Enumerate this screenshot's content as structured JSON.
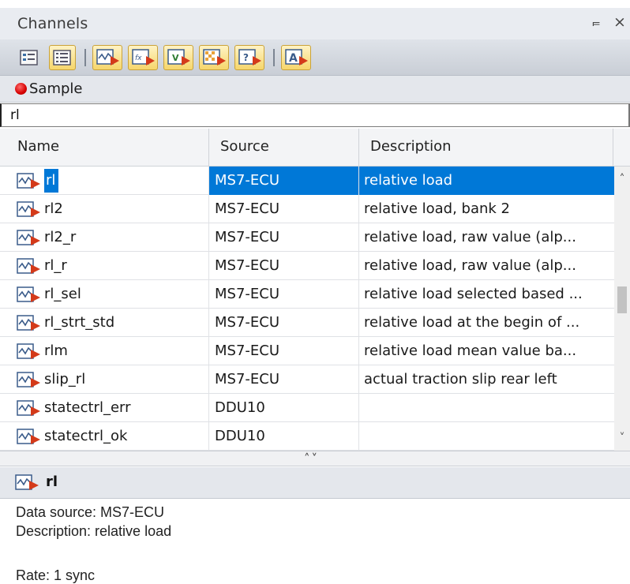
{
  "panel": {
    "title": "Channels",
    "pin_glyph": "⫭",
    "close_glyph": "×"
  },
  "toolbar": {
    "buttons": [
      {
        "icon": "list-view-icon",
        "selected": false
      },
      {
        "icon": "detail-view-icon",
        "selected": true
      },
      {
        "icon": "channel-type-icon",
        "selected": true
      },
      {
        "icon": "function-channel-icon",
        "selected": true
      },
      {
        "icon": "variable-channel-icon",
        "selected": true
      },
      {
        "icon": "map-channel-icon",
        "selected": true
      },
      {
        "icon": "unknown-channel-icon",
        "selected": true
      },
      {
        "icon": "text-channel-icon",
        "selected": true
      }
    ]
  },
  "sample": {
    "label": "Sample",
    "color": "#d60000"
  },
  "filter": {
    "value": "rl"
  },
  "table": {
    "columns": [
      "Name",
      "Source",
      "Description"
    ],
    "rows": [
      {
        "name": "rl",
        "source": "MS7-ECU",
        "description": "relative load",
        "selected": true
      },
      {
        "name": "rl2",
        "source": "MS7-ECU",
        "description": "relative load, bank 2",
        "selected": false
      },
      {
        "name": "rl2_r",
        "source": "MS7-ECU",
        "description": "relative load, raw value (alp...",
        "selected": false
      },
      {
        "name": "rl_r",
        "source": "MS7-ECU",
        "description": "relative load, raw value (alp...",
        "selected": false
      },
      {
        "name": "rl_sel",
        "source": "MS7-ECU",
        "description": "relative load selected based ...",
        "selected": false
      },
      {
        "name": "rl_strt_std",
        "source": "MS7-ECU",
        "description": "relative load at the begin of ...",
        "selected": false
      },
      {
        "name": "rlm",
        "source": "MS7-ECU",
        "description": "relative load mean value ba...",
        "selected": false
      },
      {
        "name": "slip_rl",
        "source": "MS7-ECU",
        "description": "actual traction slip rear left",
        "selected": false
      },
      {
        "name": "statectrl_err",
        "source": "DDU10",
        "description": "",
        "selected": false
      },
      {
        "name": "statectrl_ok",
        "source": "DDU10",
        "description": "",
        "selected": false
      }
    ]
  },
  "scrollbar": {
    "up_glyph": "˄",
    "down_glyph": "˅"
  },
  "splitter": {
    "glyph": "˄˅"
  },
  "detail": {
    "name": "rl",
    "data_source": "Data source: MS7-ECU",
    "description": "Description: relative load",
    "rate": "Rate: 1 sync"
  },
  "colors": {
    "selection": "#0078d7",
    "toolbar_active": "#f6d66b",
    "channel_icon_red": "#d43a1a"
  }
}
